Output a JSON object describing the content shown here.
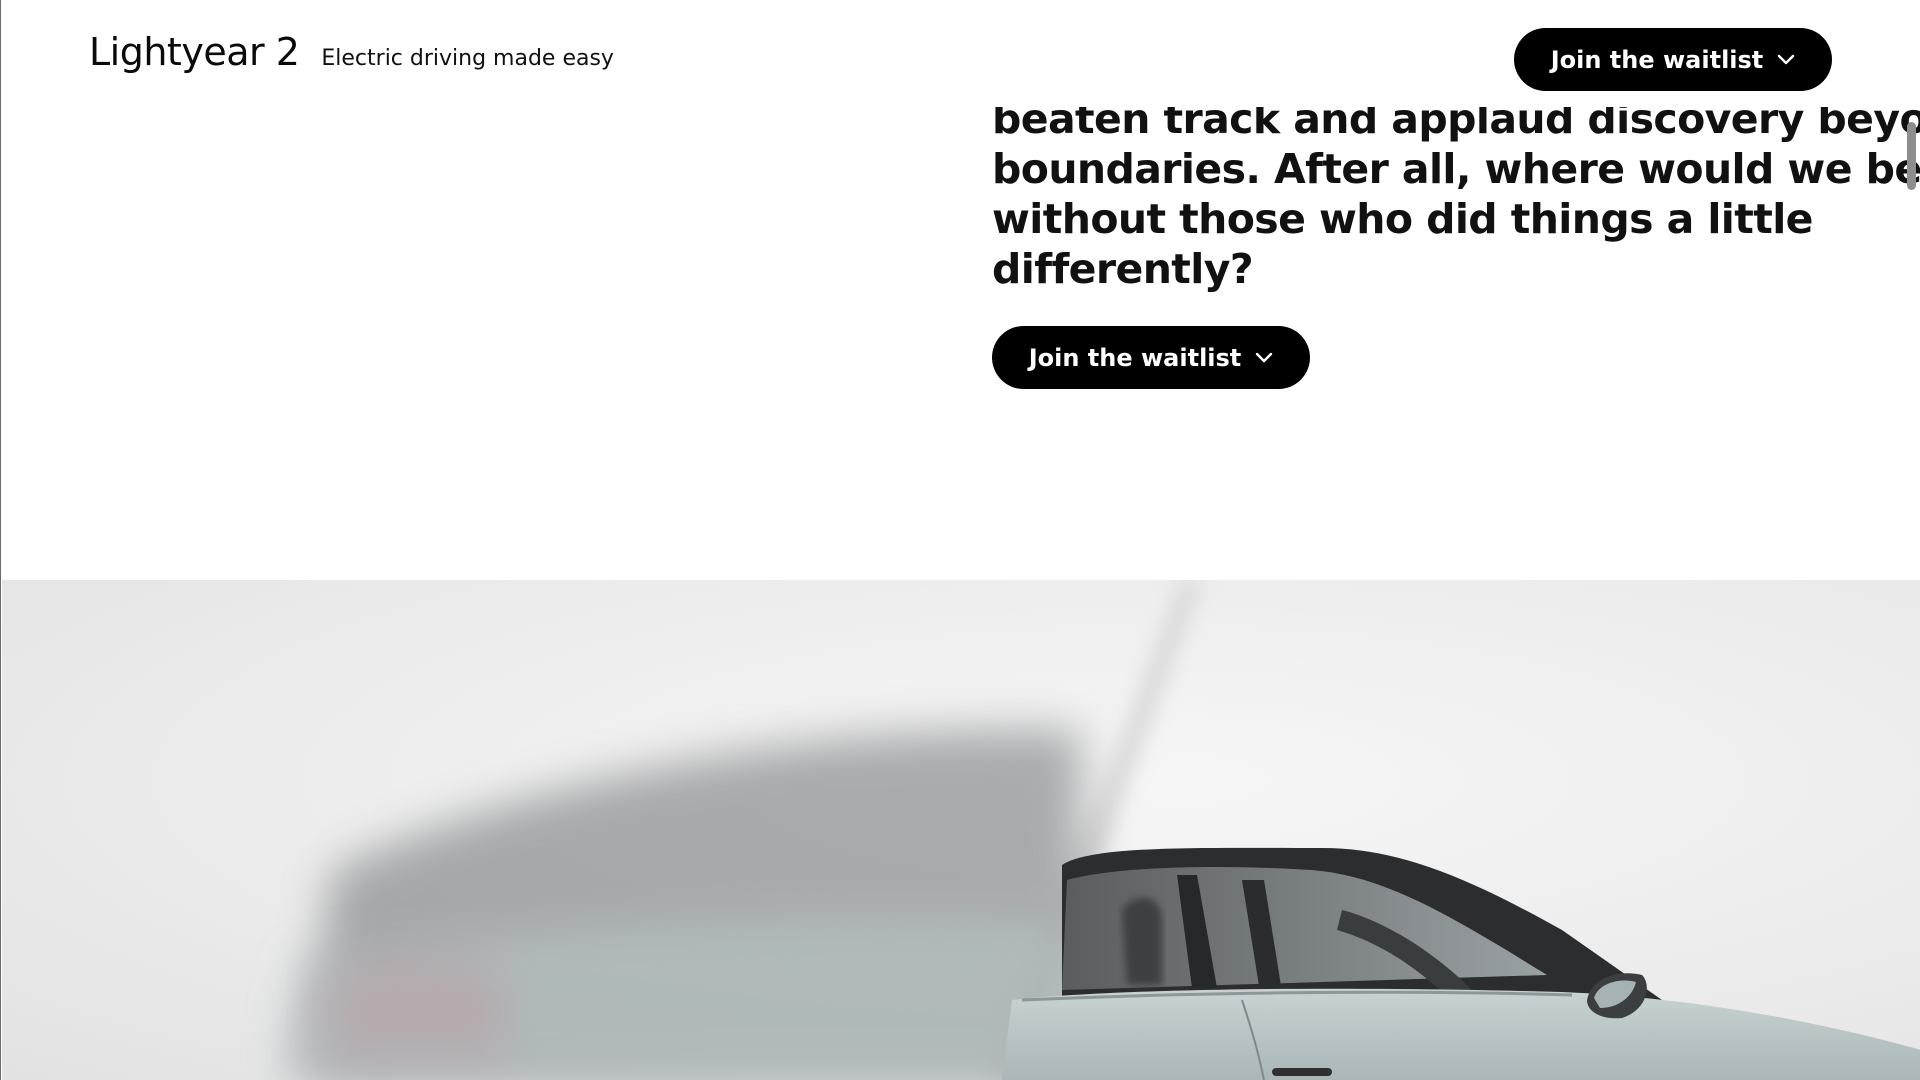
{
  "header": {
    "brand_name": "Lightyear 2",
    "tagline": "Electric driving made easy",
    "cta_label": "Join the waitlist"
  },
  "main": {
    "headline_lines": [
      "beaten track and applaud discovery beyond",
      "boundaries. After all, where would we be",
      "without those who did things a little",
      "differently?"
    ],
    "cta_label": "Join the waitlist"
  },
  "hero": {
    "image_subject": "car-photo",
    "background_color": "#ececec",
    "car_color": "#b8c4c6"
  },
  "colors": {
    "button_bg": "#000000",
    "button_text": "#ffffff",
    "page_bg": "#ffffff",
    "text": "#111111"
  },
  "icons": {
    "cta_chevron": "chevron-down-icon"
  }
}
